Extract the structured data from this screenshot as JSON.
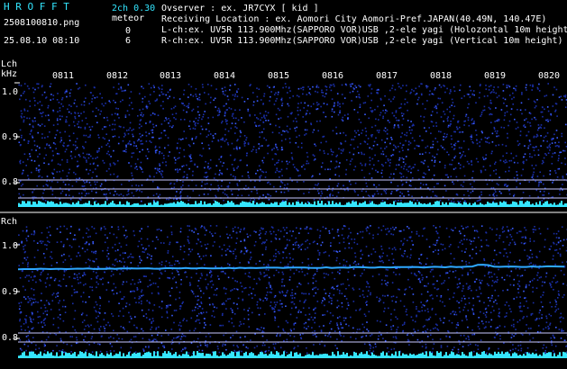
{
  "header": {
    "app_title": "H R O F F T",
    "version": "2ch 0.30",
    "filename": "2508100810.png",
    "datetime": "25.08.10 08:10",
    "meteor_label": "meteor",
    "meteor_lch": "0",
    "meteor_rch": "6",
    "observer_line": "Ovserver           : ex. JR7CYX [ kid ]",
    "location_line": "Receiving Location : ex. Aomori City Aomori-Pref.JAPAN(40.49N, 140.47E)",
    "lch_line": "L-ch:ex. UV5R 113.900Mhz(SAPPORO VOR)USB ,2-ele yagi (Holozontal 10m height)",
    "rch_line": "R-ch:ex. UV5R 113.900Mhz(SAPPORO VOR)USB ,2-ele yagi (Vertical 10m height)"
  },
  "lch": {
    "label": "Lch",
    "unit": "kHz",
    "y_ticks": [
      "1.0",
      "0.9",
      "0.8"
    ]
  },
  "rch": {
    "label": "Rch",
    "y_ticks": [
      "1.0",
      "0.9",
      "0.8"
    ]
  },
  "time_ticks": [
    "0811",
    "0812",
    "0813",
    "0814",
    "0815",
    "0816",
    "0817",
    "0818",
    "0819",
    "0820"
  ],
  "colors": {
    "background": "#000000",
    "noise": "#1a2fa8",
    "noise_bright": "#3a5cff",
    "header_text": "#35e6ff",
    "trace": "#2ea8ff",
    "level_bar": "#35e6ff",
    "ref_line": "#c8c8ff"
  }
}
